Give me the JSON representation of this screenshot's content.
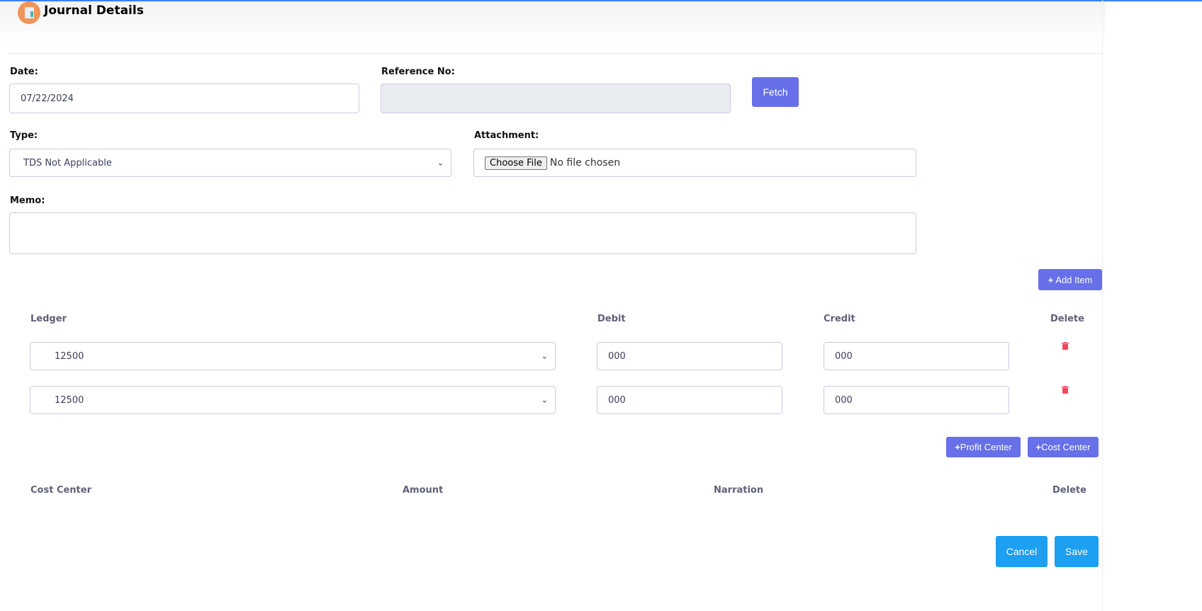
{
  "header": {
    "title": "Journal Details",
    "icon": "calculator-icon"
  },
  "form": {
    "date_label": "Date:",
    "date_value": "07/22/2024",
    "reference_label": "Reference No:",
    "reference_value": "",
    "fetch_label": "Fetch",
    "type_label": "Type:",
    "type_value": "TDS Not Applicable",
    "attachment_label": "Attachment:",
    "choose_file_label": "Choose File",
    "no_file_text": "No file chosen",
    "memo_label": "Memo:",
    "memo_value": ""
  },
  "items": {
    "add_item_label": "Add Item",
    "columns": [
      "Ledger",
      "Debit",
      "Credit",
      "Delete"
    ],
    "rows": [
      {
        "ledger": "12500",
        "debit": "000",
        "credit": "000"
      },
      {
        "ledger": "12500",
        "debit": "000",
        "credit": "000"
      }
    ]
  },
  "centers": {
    "profit_center_label": "Profit Center",
    "cost_center_label": "Cost Center",
    "columns": [
      "Cost Center",
      "Amount",
      "Narration",
      "Delete"
    ]
  },
  "footer": {
    "cancel_label": "Cancel",
    "save_label": "Save"
  },
  "colors": {
    "primary": "#6770e8",
    "action": "#1d9ff2",
    "danger": "#f0475e"
  }
}
